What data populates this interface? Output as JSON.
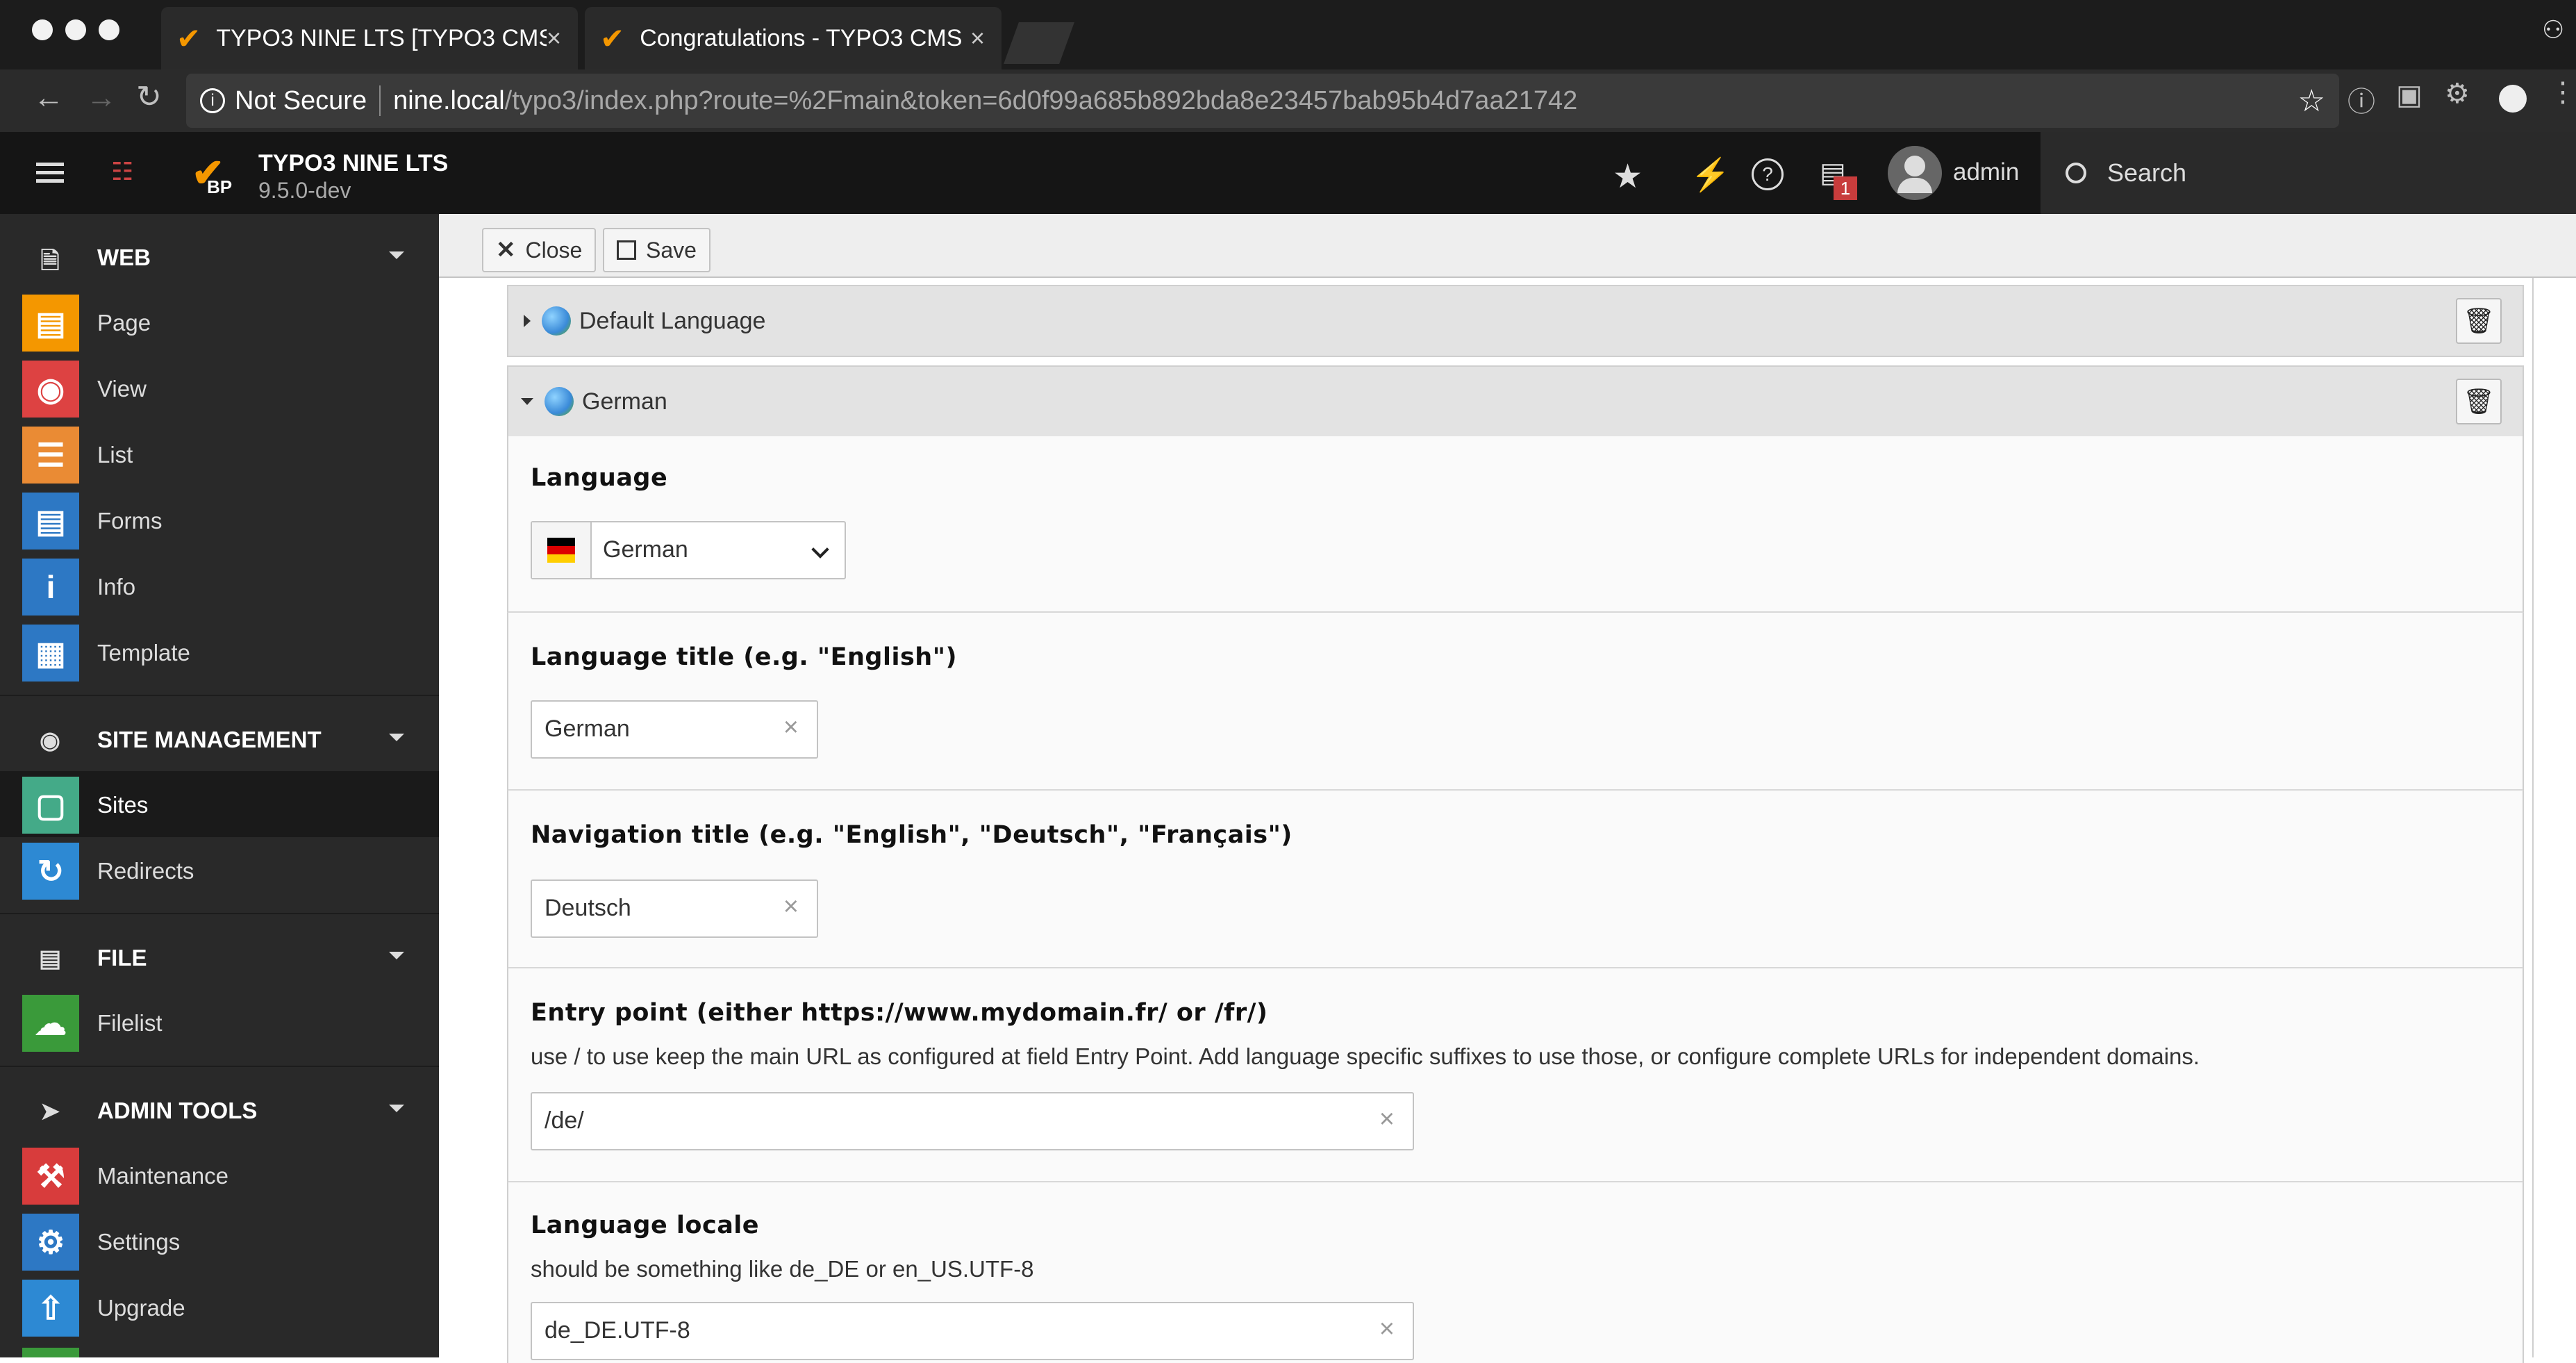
{
  "browser": {
    "tabs": [
      {
        "title": "TYPO3 NINE LTS [TYPO3 CMS",
        "fade": "S"
      },
      {
        "title": "Congratulations - TYPO3 CMS",
        "fade": "S"
      }
    ],
    "security": "Not Secure",
    "url_host": "nine.local",
    "url_path": "/typo3/index.php?route=%2Fmain&token=6d0f99a685b892bda8e23457bab95b4d7aa21742"
  },
  "topbar": {
    "site_name": "TYPO3 NINE LTS",
    "version": "9.5.0-dev",
    "logo_badge": "BP",
    "notification_count": "1",
    "user": "admin",
    "search_label": "Search"
  },
  "sidebar": {
    "groups": [
      {
        "label": "WEB",
        "icon": "page-outline-icon",
        "items": [
          {
            "label": "Page",
            "icon": "page-module-icon",
            "color": "#f49700"
          },
          {
            "label": "View",
            "icon": "eye-icon",
            "color": "#dd4242"
          },
          {
            "label": "List",
            "icon": "list-icon",
            "color": "#ea8b34"
          },
          {
            "label": "Forms",
            "icon": "forms-icon",
            "color": "#2d78c4"
          },
          {
            "label": "Info",
            "icon": "info-icon",
            "color": "#2d78c4"
          },
          {
            "label": "Template",
            "icon": "template-icon",
            "color": "#2d78c4"
          }
        ]
      },
      {
        "label": "SITE MANAGEMENT",
        "icon": "globe-icon",
        "items": [
          {
            "label": "Sites",
            "icon": "sites-icon",
            "color": "#44aa88",
            "active": true
          },
          {
            "label": "Redirects",
            "icon": "redirect-icon",
            "color": "#2d89d3"
          }
        ]
      },
      {
        "label": "FILE",
        "icon": "image-icon",
        "items": [
          {
            "label": "Filelist",
            "icon": "filelist-icon",
            "color": "#3a9a3a"
          }
        ]
      },
      {
        "label": "ADMIN TOOLS",
        "icon": "rocket-icon",
        "items": [
          {
            "label": "Maintenance",
            "icon": "wrench-icon",
            "color": "#d83c3c"
          },
          {
            "label": "Settings",
            "icon": "gears-icon",
            "color": "#2d78c4"
          },
          {
            "label": "Upgrade",
            "icon": "upgrade-icon",
            "color": "#2d89d3"
          }
        ]
      }
    ]
  },
  "docheader": {
    "close_label": "Close",
    "save_label": "Save"
  },
  "panels": {
    "default_language": "Default Language",
    "german": "German"
  },
  "fields": {
    "language": {
      "label": "Language",
      "value": "German"
    },
    "language_title": {
      "label": "Language title (e.g. \"English\")",
      "value": "German"
    },
    "navigation_title": {
      "label": "Navigation title (e.g. \"English\", \"Deutsch\", \"Français\")",
      "value": "Deutsch"
    },
    "entry_point": {
      "label": "Entry point (either https://www.mydomain.fr/ or /fr/)",
      "description": "use / to use keep the main URL as configured at field Entry Point. Add language specific suffixes to use those, or configure complete URLs for independent domains.",
      "value": "/de/"
    },
    "locale": {
      "label": "Language locale",
      "description": "should be something like de_DE or en_US.UTF-8",
      "value": "de_DE.UTF-8"
    }
  }
}
